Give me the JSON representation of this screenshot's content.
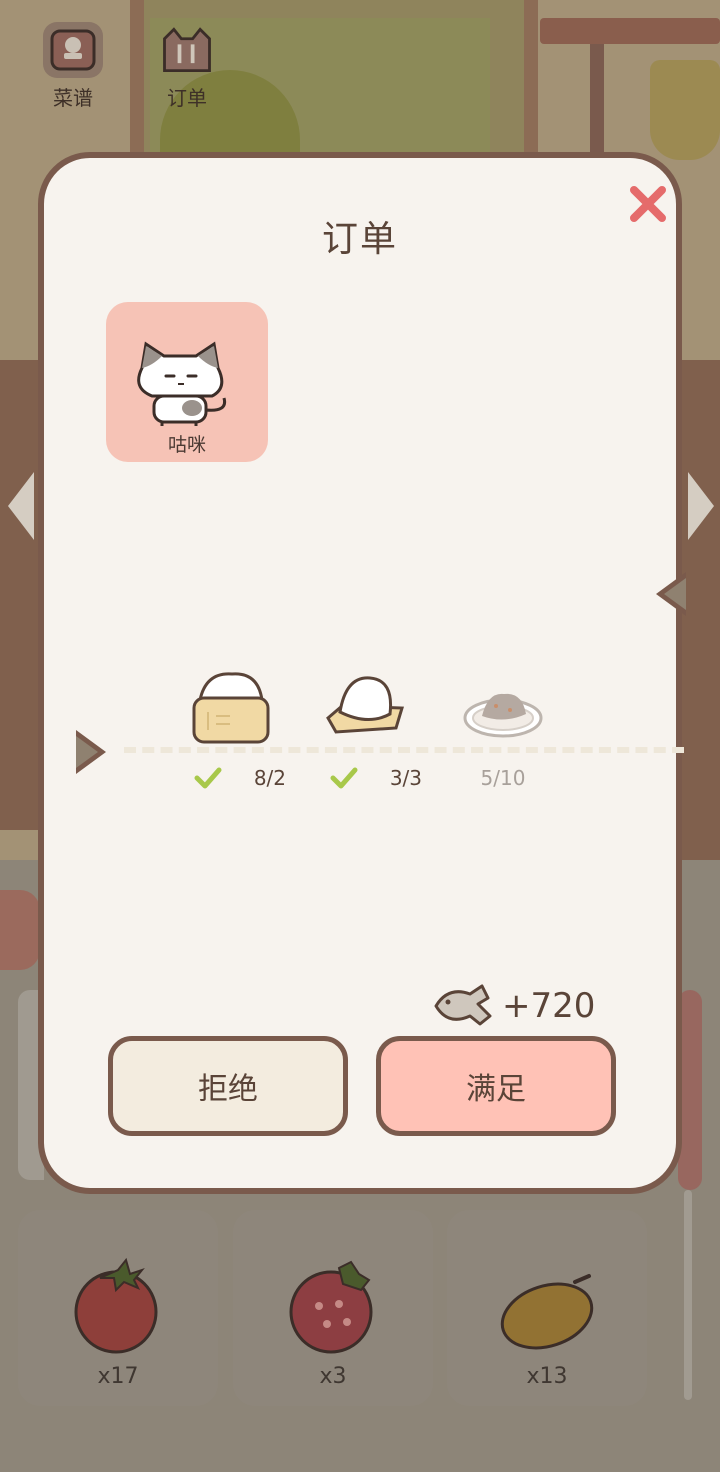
{
  "nav": {
    "recipes_label": "菜谱",
    "orders_label": "订单"
  },
  "dialog": {
    "title": "订单",
    "customer": {
      "name": "咕咪"
    },
    "dishes": [
      {
        "icon": "steamed-buns-basket-icon",
        "status": "8/2",
        "complete": true
      },
      {
        "icon": "mochi-on-tray-icon",
        "status": "3/3",
        "complete": true
      },
      {
        "icon": "stew-plate-icon",
        "status": "5/10",
        "complete": false
      }
    ],
    "reward": {
      "icon": "fish-coin-icon",
      "value": "+720"
    },
    "buttons": {
      "refuse": "拒绝",
      "accept": "满足"
    }
  },
  "inventory": [
    {
      "item": "tomato-icon",
      "count": "x17"
    },
    {
      "item": "strawberry-icon",
      "count": "x3"
    },
    {
      "item": "mango-icon",
      "count": "x13"
    }
  ],
  "colors": {
    "dialog_bg": "#f7f3ee",
    "border": "#7a5a4c",
    "accent_pink": "#ffc2b6",
    "check_green": "#a8c84a",
    "close_red": "#e56b6b"
  }
}
